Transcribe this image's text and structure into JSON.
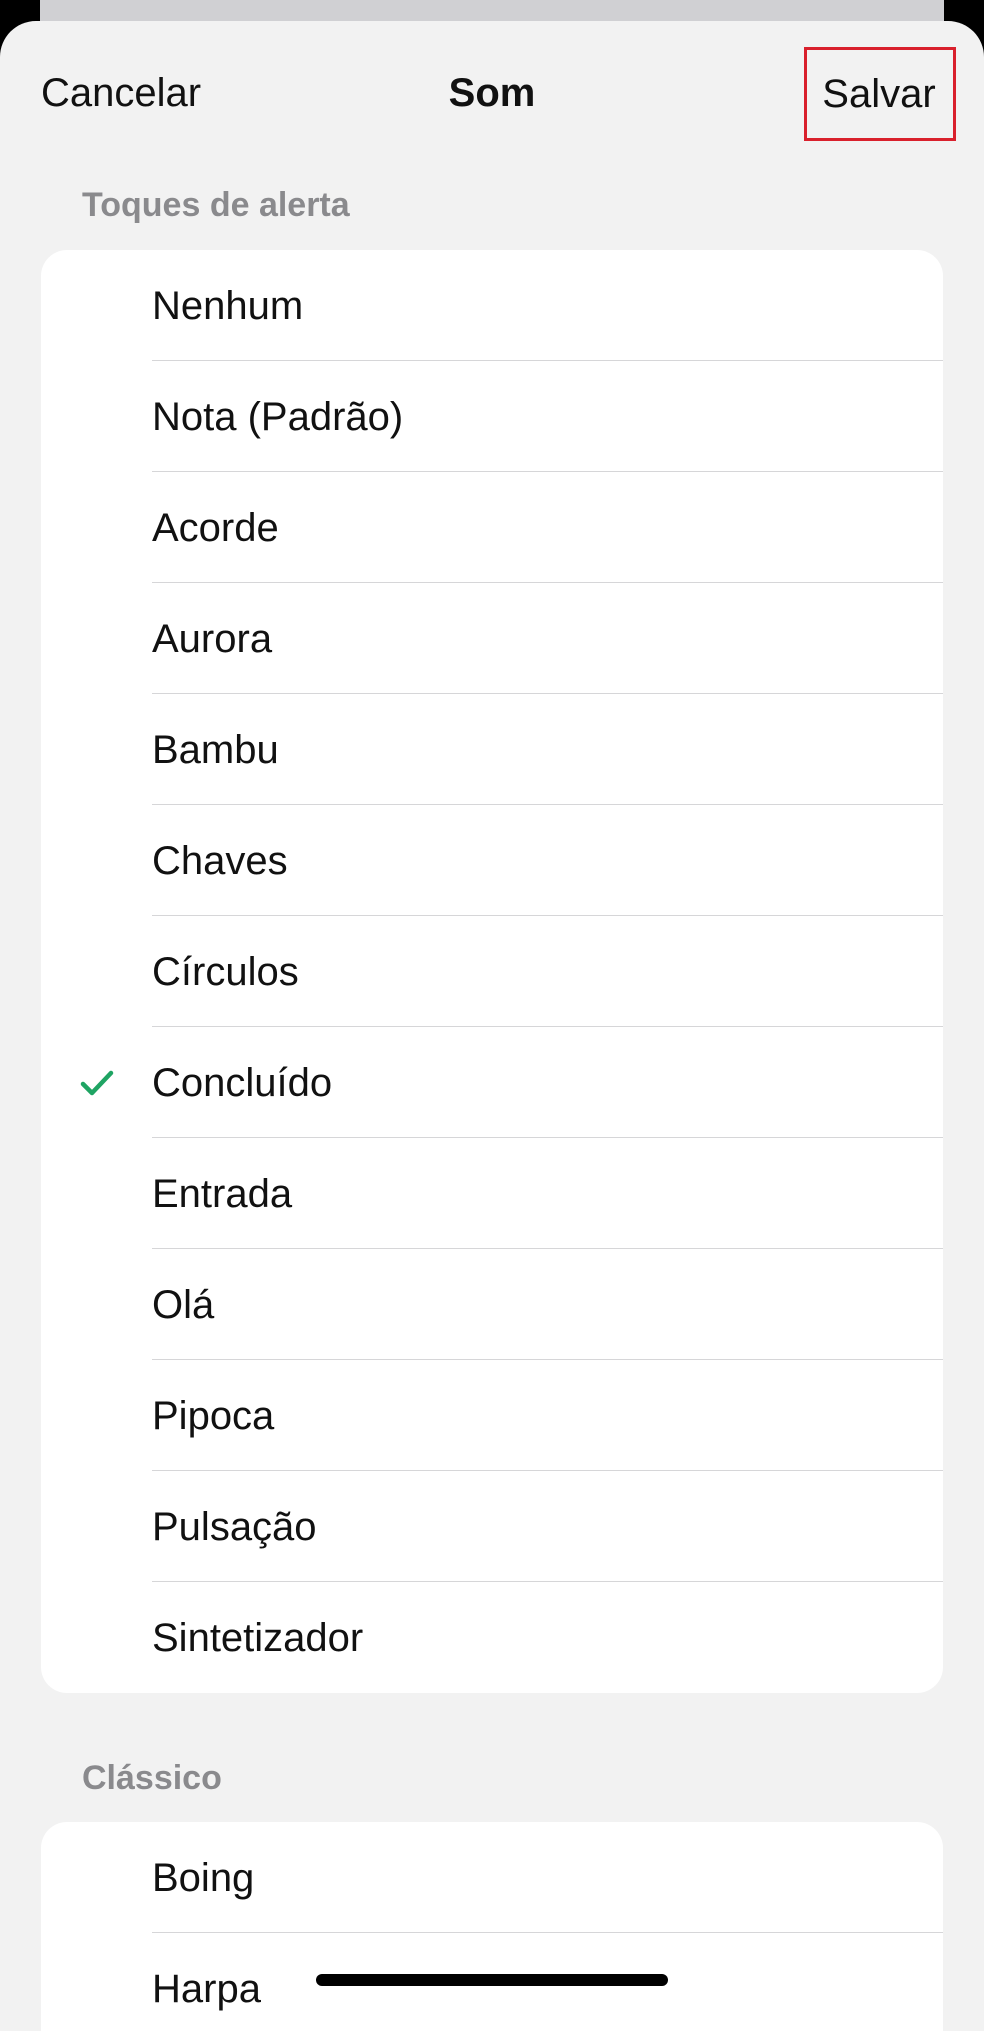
{
  "nav": {
    "cancel_label": "Cancelar",
    "title": "Som",
    "save_label": "Salvar"
  },
  "sections": [
    {
      "header": "Toques de alerta",
      "items": [
        {
          "label": "Nenhum",
          "selected": false
        },
        {
          "label": "Nota (Padrão)",
          "selected": false
        },
        {
          "label": "Acorde",
          "selected": false
        },
        {
          "label": "Aurora",
          "selected": false
        },
        {
          "label": "Bambu",
          "selected": false
        },
        {
          "label": "Chaves",
          "selected": false
        },
        {
          "label": "Círculos",
          "selected": false
        },
        {
          "label": "Concluído",
          "selected": true
        },
        {
          "label": "Entrada",
          "selected": false
        },
        {
          "label": "Olá",
          "selected": false
        },
        {
          "label": "Pipoca",
          "selected": false
        },
        {
          "label": "Pulsação",
          "selected": false
        },
        {
          "label": "Sintetizador",
          "selected": false
        }
      ]
    },
    {
      "header": "Clássico",
      "items": [
        {
          "label": "Boing",
          "selected": false
        },
        {
          "label": "Harpa",
          "selected": false
        }
      ]
    }
  ],
  "colors": {
    "checkmark": "#1fa463",
    "highlight_box": "#d9202c"
  },
  "icons": {
    "selected_mark": "checkmark-icon"
  }
}
